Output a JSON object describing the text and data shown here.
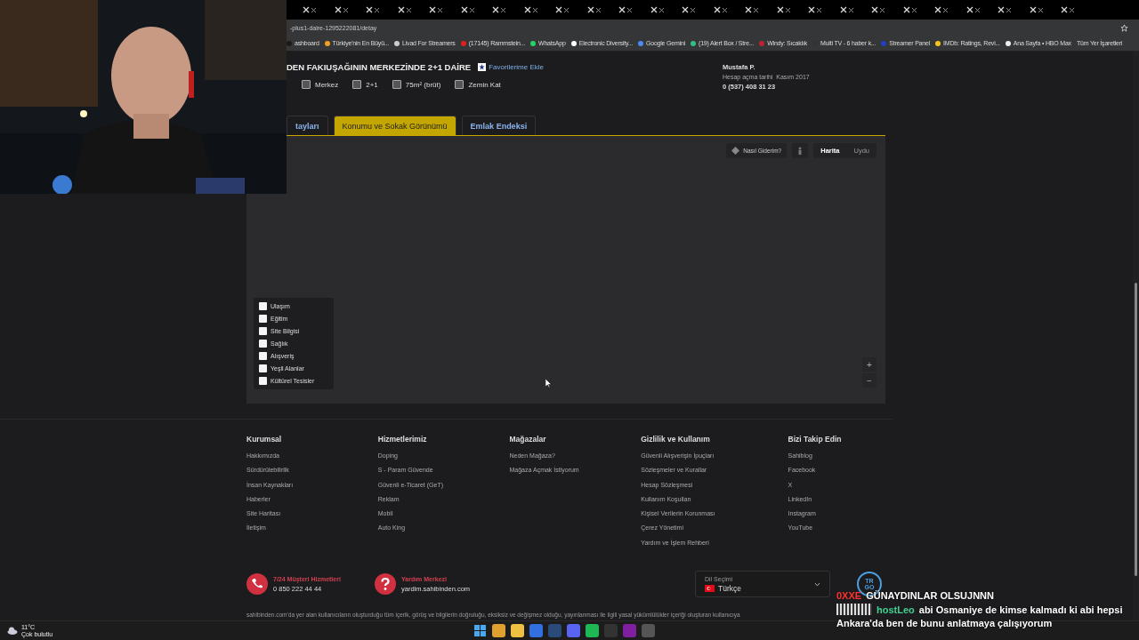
{
  "browser": {
    "url": "-plus1-daire-1295222081/detay",
    "bookmarks": [
      {
        "label": "ashboard",
        "color": "#1a1a1a"
      },
      {
        "label": "Türkiye'nin En Büyü...",
        "color": "#f0a020"
      },
      {
        "label": "Livad For Streamers",
        "color": "#cccccc"
      },
      {
        "label": "(17145) Rammstein...",
        "color": "#e02020"
      },
      {
        "label": "WhatsApp",
        "color": "#25d366"
      },
      {
        "label": "Electronic Diversity...",
        "color": "#ffffff"
      },
      {
        "label": "Google Gemini",
        "color": "#4a8af4"
      },
      {
        "label": "(19) Alert Box / Stre...",
        "color": "#30c080"
      },
      {
        "label": "Windy: Sıcaklık",
        "color": "#c02030"
      },
      {
        "label": "Multi TV - 6 haber k...",
        "color": "#333333"
      },
      {
        "label": "Streamer Panel",
        "color": "#2040c0"
      },
      {
        "label": "IMDb: Ratings, Revi...",
        "color": "#f5c518"
      },
      {
        "label": "Ana Sayfa • HBO Max",
        "color": "#eeeeee"
      }
    ],
    "all_bookmarks": "Tüm Yer İşaretleri"
  },
  "listing": {
    "title": "DEN FAKIUŞAĞININ MERKEZİNDE 2+1 DAİRE",
    "favorite_label": "Favorilerime Ekle",
    "features": [
      "Merkez",
      "2+1",
      "75m² (brüt)",
      "Zemin Kat"
    ],
    "seller": {
      "name": "Mustafa P.",
      "member_since_label": "Hesap açma tarihi",
      "member_since": "Kasım 2017",
      "phone": "0 (537) 408 31 23"
    }
  },
  "tabs": [
    {
      "label": "tayları",
      "selected": false
    },
    {
      "label": "Konumu ve Sokak Görünümü",
      "selected": true
    },
    {
      "label": "Emlak Endeksi",
      "selected": false
    }
  ],
  "map": {
    "directions_label": "Nasıl Giderim?",
    "map_types": [
      {
        "label": "Harita",
        "selected": true
      },
      {
        "label": "Uydu",
        "selected": false
      }
    ],
    "layers": [
      {
        "label": "Ulaşım",
        "checked": false
      },
      {
        "label": "Eğitim",
        "checked": false
      },
      {
        "label": "Site Bilgisi",
        "checked": false
      },
      {
        "label": "Sağlık",
        "checked": false
      },
      {
        "label": "Alışveriş",
        "checked": false
      },
      {
        "label": "Yeşil Alanlar",
        "checked": false
      },
      {
        "label": "Kültürel Tesisler",
        "checked": false
      }
    ],
    "zoom_in": "+",
    "zoom_out": "−"
  },
  "footer": {
    "columns": [
      {
        "heading": "Kurumsal",
        "links": [
          "Hakkımızda",
          "Sürdürülebilirlik",
          "İnsan Kaynakları",
          "Haberler",
          "Site Haritası",
          "İletişim"
        ]
      },
      {
        "heading": "Hizmetlerimiz",
        "links": [
          "Doping",
          "S - Param Güvende",
          "Güvenli e-Ticaret (GeT)",
          "Reklam",
          "Mobil",
          "Auto King"
        ]
      },
      {
        "heading": "Mağazalar",
        "links": [
          "Neden Mağaza?",
          "Mağaza Açmak İstiyorum"
        ]
      },
      {
        "heading": "Gizlilik ve Kullanım",
        "links": [
          "Güvenli Alışverişin İpuçları",
          "Sözleşmeler ve Kurallar",
          "Hesap Sözleşmesi",
          "Kullanım Koşulları",
          "Kişisel Verilerin Korunması",
          "Çerez Yönetimi",
          "Yardım ve İşlem Rehberi"
        ]
      },
      {
        "heading": "Bizi Takip Edin",
        "links": [
          "Sahiblog",
          "Facebook",
          "X",
          "LinkedIn",
          "Instagram",
          "YouTube"
        ]
      }
    ],
    "contacts": [
      {
        "kind": "phone",
        "title": "7/24 Müşteri Hizmetleri",
        "detail": "0 850 222 44 44"
      },
      {
        "kind": "help",
        "title": "Yardım Merkezi",
        "detail": "yardim.sahibinden.com"
      }
    ],
    "language": {
      "label": "Dil Seçimi",
      "value": "Türkçe"
    },
    "trgo": "TR GO",
    "disclaimer": "sahibinden.com'da yer alan kullanıcıların oluşturduğu tüm içerik, görüş ve bilgilerin doğruluğu, eksiksiz ve değişmez olduğu, yayınlanması ile ilgili yasal yükümlülükler içeriği oluşturan kullanıcıya"
  },
  "chat": [
    {
      "user": "0XXE",
      "message": "GÜNAYDINLAR OLSUJNNN",
      "color": "#ff3030"
    },
    {
      "user": "hostLeo",
      "message": "abi Osmaniye de kimse kalmadı ki abi hepsi",
      "color": "#40d090"
    },
    {
      "message": "Ankara'da ben de bunu anlatmaya çalışıyorum"
    }
  ],
  "taskbar": {
    "temperature": "11°C",
    "condition": "Çok bulutlu"
  }
}
